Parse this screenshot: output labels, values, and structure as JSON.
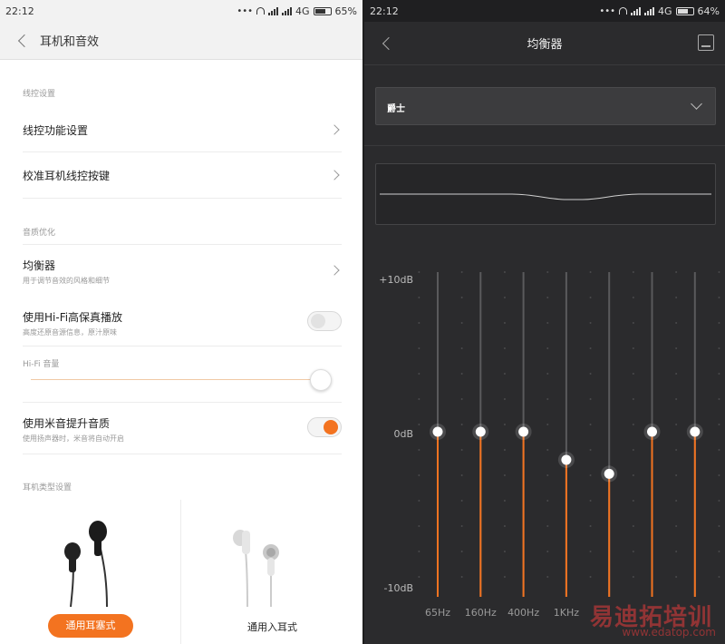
{
  "left": {
    "status": {
      "time": "22:12",
      "network": "4G",
      "battery": "65%"
    },
    "title": "耳机和音效",
    "sections": {
      "wire": "线控设置",
      "sound": "音质优化",
      "type": "耳机类型设置"
    },
    "rows": {
      "wire_function": "线控功能设置",
      "calibrate": "校准耳机线控按键",
      "equalizer": "均衡器",
      "equalizer_sub": "用于调节音效的风格和细节",
      "hifi": "使用Hi-Fi高保真播放",
      "hifi_sub": "高度还原音源信息，原汁原味",
      "hifi_volume": "Hi-Fi 音量",
      "mi_sound": "使用米音提升音质",
      "mi_sound_sub": "使用扬声器时，米音将自动开启"
    },
    "toggles": {
      "hifi_on": false,
      "mi_sound_on": true
    },
    "hifi_volume_level": 1.0,
    "earphones": {
      "earbud": "通用耳塞式",
      "in_ear": "通用入耳式"
    }
  },
  "right": {
    "status": {
      "time": "22:12",
      "network": "4G",
      "battery": "64%"
    },
    "title": "均衡器",
    "preset": "爵士",
    "db_labels": {
      "top": "+10dB",
      "mid": "0dB",
      "bottom": "-10dB"
    },
    "bands": [
      {
        "freq": "65Hz",
        "gain_db": 0
      },
      {
        "freq": "160Hz",
        "gain_db": 0
      },
      {
        "freq": "400Hz",
        "gain_db": 0
      },
      {
        "freq": "1KHz",
        "gain_db": -2
      },
      {
        "freq": "",
        "gain_db": -3
      },
      {
        "freq": "",
        "gain_db": 0
      },
      {
        "freq": "",
        "gain_db": 0
      }
    ],
    "accent": "#f37320"
  },
  "watermark": {
    "main": "易迪拓培训",
    "sub": "www.edatop.com"
  }
}
